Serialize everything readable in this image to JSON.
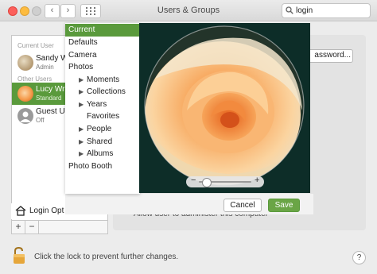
{
  "window": {
    "title": "Users & Groups"
  },
  "search": {
    "value": "login"
  },
  "users": {
    "current_section": "Current User",
    "other_section": "Other Users",
    "items": [
      {
        "name": "Sandy Wr",
        "role": "Admin"
      },
      {
        "name": "Lucy Writ",
        "role": "Standard"
      },
      {
        "name": "Guest Us",
        "role": "Off"
      }
    ],
    "login_options": "Login Opt"
  },
  "panel": {
    "password_button": "assword...",
    "allow_text": "Allow user to administer this computer"
  },
  "picker_menu": {
    "items": [
      {
        "label": "Current",
        "selected": true,
        "level": 0,
        "arrow": false
      },
      {
        "label": "Defaults",
        "level": 0,
        "arrow": false
      },
      {
        "label": "Camera",
        "level": 0,
        "arrow": false
      },
      {
        "label": "Photos",
        "level": 0,
        "arrow": false
      },
      {
        "label": "Moments",
        "level": 1,
        "arrow": true
      },
      {
        "label": "Collections",
        "level": 1,
        "arrow": true
      },
      {
        "label": "Years",
        "level": 1,
        "arrow": true
      },
      {
        "label": "Favorites",
        "level": 1,
        "arrow": false
      },
      {
        "label": "People",
        "level": 1,
        "arrow": true
      },
      {
        "label": "Shared",
        "level": 1,
        "arrow": true
      },
      {
        "label": "Albums",
        "level": 1,
        "arrow": true
      },
      {
        "label": "Photo Booth",
        "level": 0,
        "arrow": false
      }
    ]
  },
  "buttons": {
    "cancel": "Cancel",
    "save": "Save"
  },
  "lock_text": "Click the lock to prevent further changes.",
  "help": "?",
  "accent": "#5a9a3c"
}
